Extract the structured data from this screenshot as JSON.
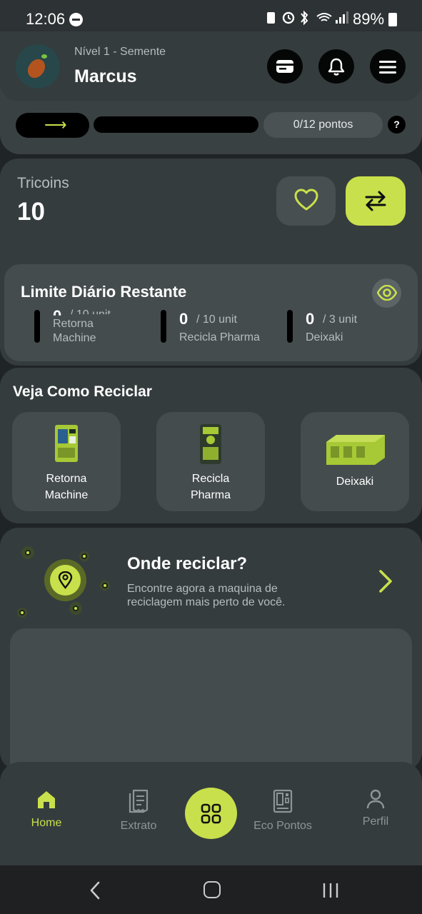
{
  "status_bar": {
    "time": "12:06",
    "icons": [
      "dnd-icon",
      "battery-saver-icon",
      "alarm-icon",
      "bluetooth-icon",
      "wifi-icon",
      "signal-icon"
    ],
    "battery": "89%"
  },
  "header": {
    "level": "Nível 1 - Semente",
    "user_name": "Marcus",
    "buttons": [
      "card-icon",
      "bell-icon",
      "menu-icon"
    ],
    "progress": {
      "fraction": 0,
      "label": "0/12 pontos",
      "help": "?"
    }
  },
  "tricoins": {
    "label": "Tricoins",
    "value": "10"
  },
  "daily_limit": {
    "title": "Limite Diário Restante",
    "items": [
      {
        "value": "0",
        "max": "/ 10 unit",
        "name": "Retorna Machine"
      },
      {
        "value": "0",
        "max": "/ 10 unit",
        "name": "Recicla Pharma"
      },
      {
        "value": "0",
        "max": "/ 3 unit",
        "name": "Deixaki"
      }
    ]
  },
  "recycle": {
    "title": "Veja Como Reciclar",
    "machines": [
      {
        "name_line1": "Retorna",
        "name_line2": "Machine"
      },
      {
        "name_line1": "Recicla",
        "name_line2": "Pharma"
      },
      {
        "name_line1": "Deixaki",
        "name_line2": ""
      }
    ]
  },
  "where": {
    "title": "Onde reciclar?",
    "description": "Encontre agora a maquina de reciclagem mais perto de você."
  },
  "bottom_nav": {
    "items": [
      {
        "label": "Home",
        "icon": "home-icon"
      },
      {
        "label": "Extrato",
        "icon": "receipt-icon"
      },
      {
        "label": "Eco Pontos",
        "icon": "machine-icon"
      },
      {
        "label": "Perfil",
        "icon": "person-icon"
      }
    ],
    "center_icon": "grid-icon"
  },
  "colors": {
    "accent": "#c8e04b",
    "background": "#1f2426",
    "card": "#353c3e"
  }
}
